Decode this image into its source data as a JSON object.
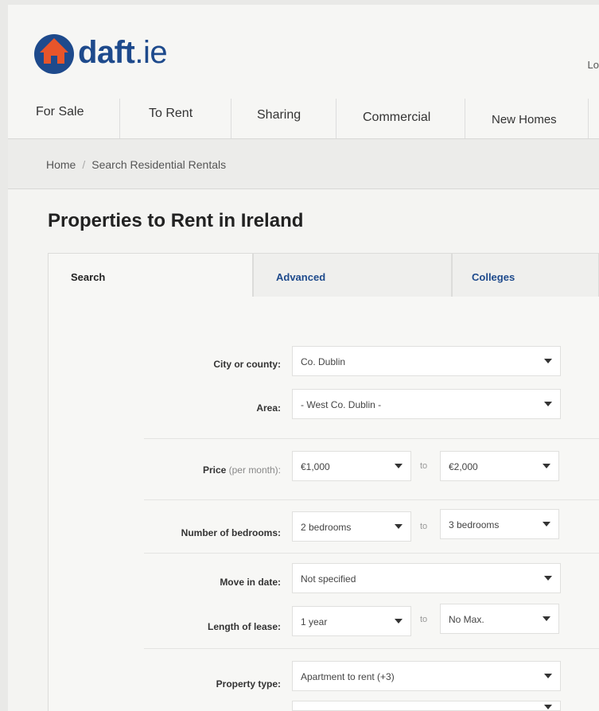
{
  "logo": {
    "brand": "daft",
    "suffix": ".ie"
  },
  "header": {
    "login_label": "Lo"
  },
  "nav": [
    "For Sale",
    "To Rent",
    "Sharing",
    "Commercial",
    "New Homes"
  ],
  "breadcrumb": {
    "home": "Home",
    "separator": "/",
    "current": "Search Residential Rentals"
  },
  "page_title": "Properties to Rent in Ireland",
  "tabs": [
    "Search",
    "Advanced",
    "Colleges"
  ],
  "form": {
    "city": {
      "label": "City or county:",
      "value": "Co. Dublin"
    },
    "area": {
      "label": "Area:",
      "value": "- West Co. Dublin -"
    },
    "price": {
      "label": "Price",
      "label_sub": "(per month):",
      "min": "€1,000",
      "max": "€2,000"
    },
    "bedrooms": {
      "label": "Number of bedrooms:",
      "min": "2 bedrooms",
      "max": "3 bedrooms"
    },
    "move_in": {
      "label": "Move in date:",
      "value": "Not specified"
    },
    "lease": {
      "label": "Length of lease:",
      "min": "1 year",
      "max": "No Max."
    },
    "property_type": {
      "label": "Property type:",
      "value": "Apartment to rent (+3)"
    },
    "range_separator": "to"
  },
  "colors": {
    "brand_blue": "#1e4a8c",
    "brand_orange": "#e8552a"
  }
}
